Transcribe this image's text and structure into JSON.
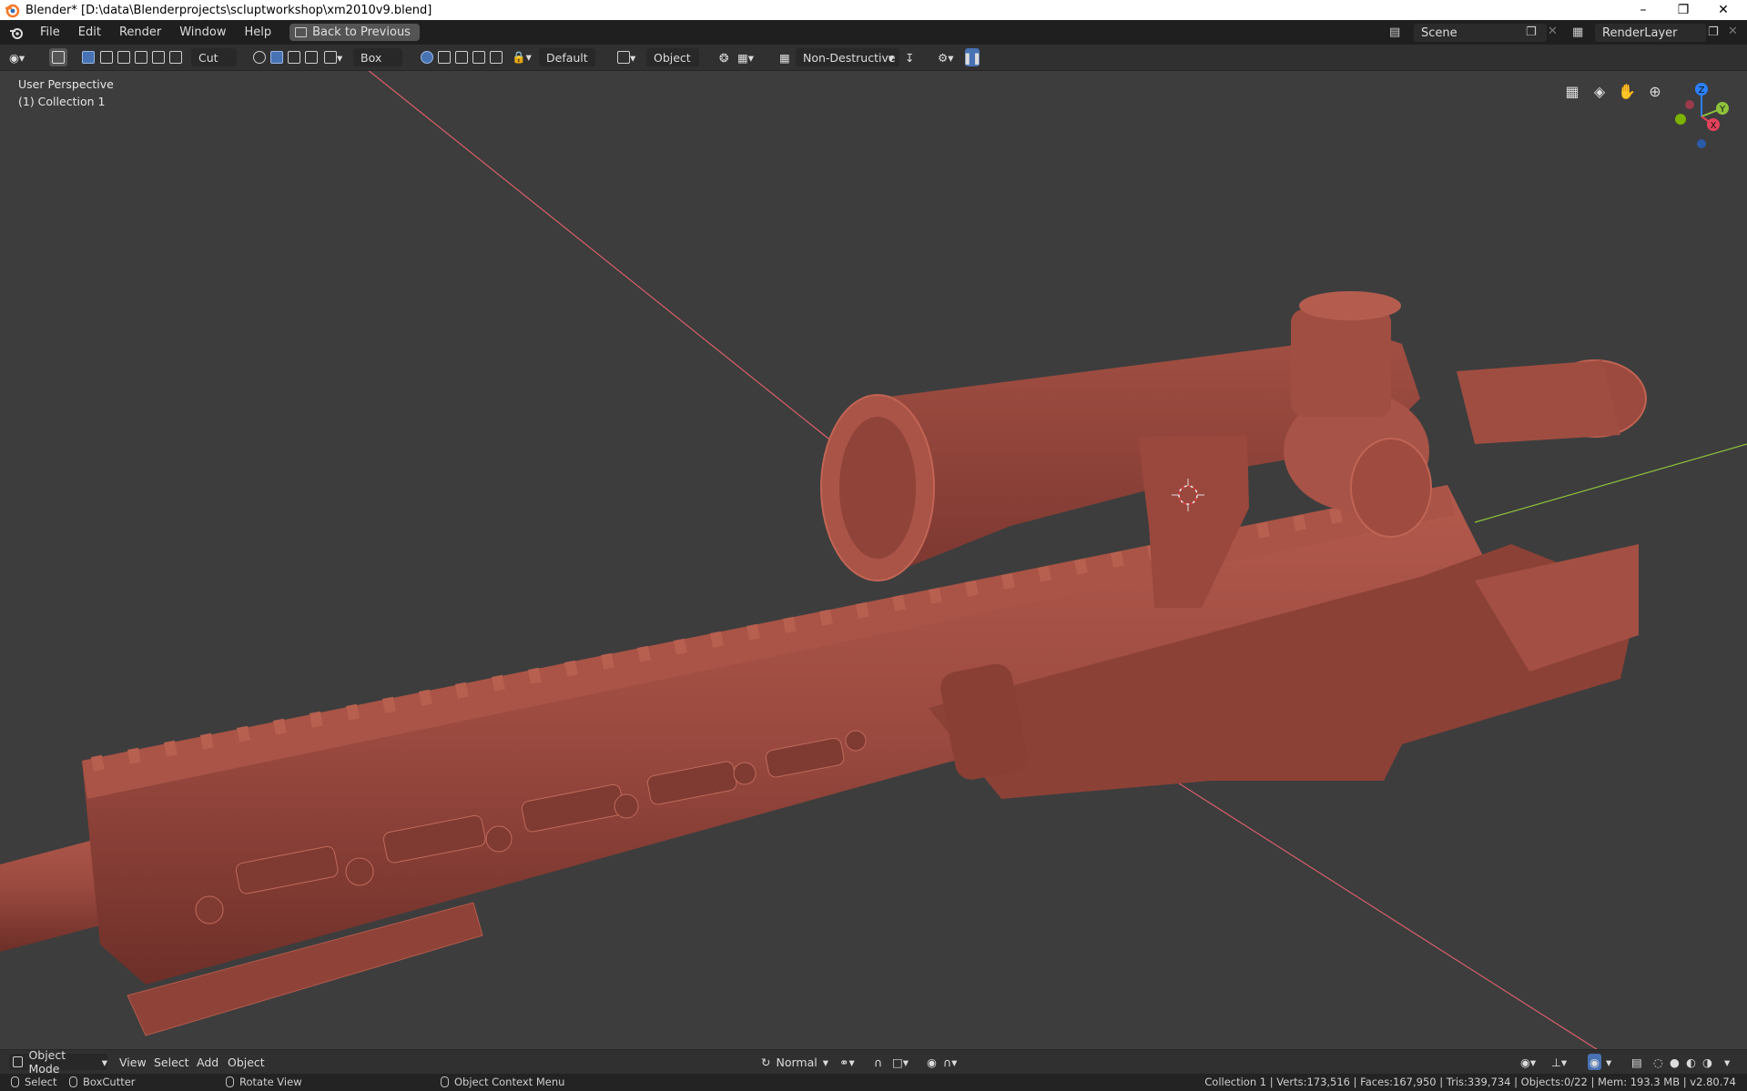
{
  "window": {
    "title": "Blender* [D:\\data\\Blenderprojects\\scluptworkshop\\xm2010v9.blend]",
    "minimize": "–",
    "restore": "❐",
    "close": "✕"
  },
  "menu": {
    "items": [
      "File",
      "Edit",
      "Render",
      "Window",
      "Help"
    ],
    "back_button": "Back to Previous",
    "scene": "Scene",
    "render_layer": "RenderLayer"
  },
  "tool_header": {
    "cut_label": "Cut",
    "shape_label": "Box",
    "default_label": "Default",
    "object_label": "Object",
    "non_destructive_label": "Non-Destructive"
  },
  "viewport": {
    "perspective": "User Perspective",
    "collection": "(1) Collection 1",
    "gizmo": {
      "z": "Z",
      "y": "Y",
      "x": "X"
    }
  },
  "bottom_header": {
    "mode": "Object Mode",
    "menus": [
      "View",
      "Select",
      "Add",
      "Object"
    ],
    "orientation": "Normal"
  },
  "status_bar": {
    "select": "Select",
    "boxcutter": "BoxCutter",
    "rotate": "Rotate View",
    "context_menu": "Object Context Menu",
    "stats": "Collection 1 | Verts:173,516 | Faces:167,950 | Tris:339,734 | Objects:0/22 | Mem: 193.3 MB | v2.80.74"
  },
  "colors": {
    "viewport_bg": "#3d3d3d",
    "model": "#9b4a40",
    "accent": "#4772b3",
    "axis_x": "#d95f6a",
    "axis_y": "#8fc23c"
  }
}
